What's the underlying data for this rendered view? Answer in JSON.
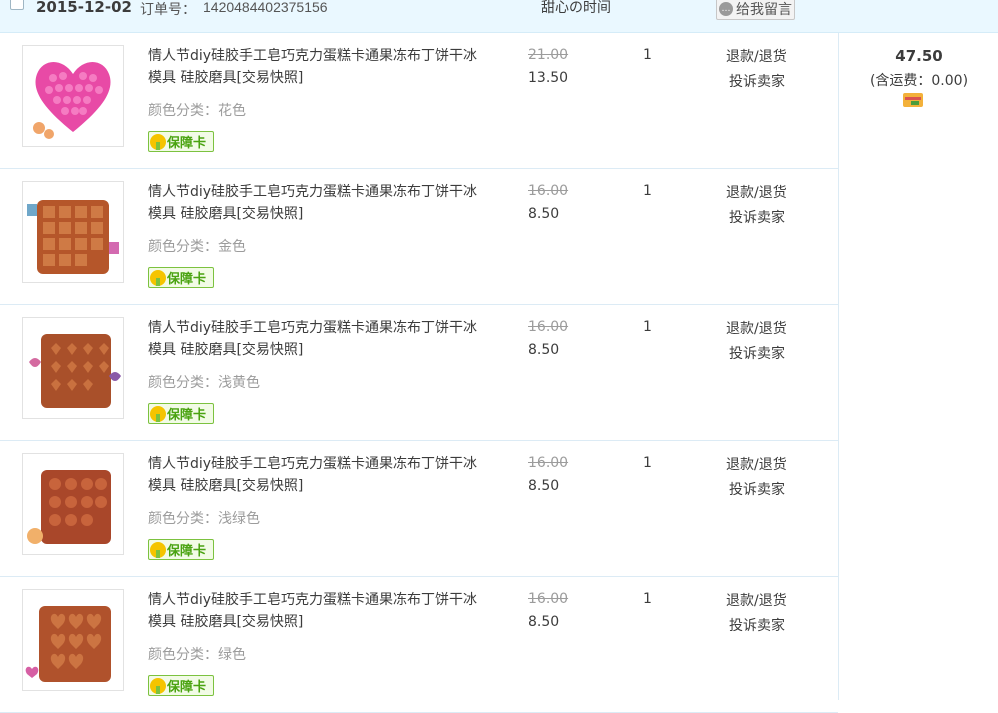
{
  "order": {
    "date": "2015-12-02",
    "order_label": "订单号：",
    "order_number": "1420484402375156",
    "shop_name": "甜心の时间",
    "message_button": "给我留言",
    "total": "47.50",
    "shipping": "(含运费：0.00)"
  },
  "items": [
    {
      "title": "情人节diy硅胶手工皂巧克力蛋糕卡通果冻布丁饼干冰模具 硅胶磨具[交易快照]",
      "spec": "颜色分类：花色",
      "badge": "保障卡",
      "price_old": "21.00",
      "price_new": "13.50",
      "qty": "1",
      "refund": "退款/退货",
      "complain": "投诉卖家",
      "image_color": "#e84aa6"
    },
    {
      "title": "情人节diy硅胶手工皂巧克力蛋糕卡通果冻布丁饼干冰模具 硅胶磨具[交易快照]",
      "spec": "颜色分类：金色",
      "badge": "保障卡",
      "price_old": "16.00",
      "price_new": "8.50",
      "qty": "1",
      "refund": "退款/退货",
      "complain": "投诉卖家",
      "image_color": "#b5562a"
    },
    {
      "title": "情人节diy硅胶手工皂巧克力蛋糕卡通果冻布丁饼干冰模具 硅胶磨具[交易快照]",
      "spec": "颜色分类：浅黄色",
      "badge": "保障卡",
      "price_old": "16.00",
      "price_new": "8.50",
      "qty": "1",
      "refund": "退款/退货",
      "complain": "投诉卖家",
      "image_color": "#a9502a"
    },
    {
      "title": "情人节diy硅胶手工皂巧克力蛋糕卡通果冻布丁饼干冰模具 硅胶磨具[交易快照]",
      "spec": "颜色分类：浅绿色",
      "badge": "保障卡",
      "price_old": "16.00",
      "price_new": "8.50",
      "qty": "1",
      "refund": "退款/退货",
      "complain": "投诉卖家",
      "image_color": "#a9472a"
    },
    {
      "title": "情人节diy硅胶手工皂巧克力蛋糕卡通果冻布丁饼干冰模具 硅胶磨具[交易快照]",
      "spec": "颜色分类：绿色",
      "badge": "保障卡",
      "price_old": "16.00",
      "price_new": "8.50",
      "qty": "1",
      "refund": "退款/退货",
      "complain": "投诉卖家",
      "image_color": "#b0522c"
    }
  ]
}
